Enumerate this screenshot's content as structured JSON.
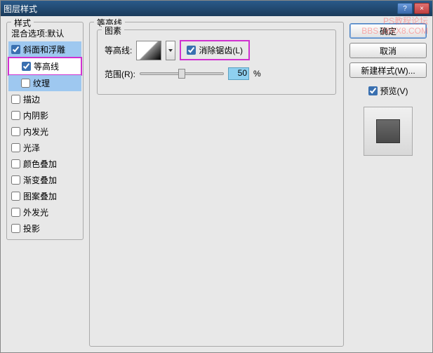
{
  "window": {
    "title": "图层样式"
  },
  "watermark": {
    "line1": "PS教程论坛",
    "line2": "BBS.16XX8.COM"
  },
  "sidebar": {
    "legend": "样式",
    "header": "混合选项:默认",
    "items": [
      {
        "label": "斜面和浮雕",
        "checked": true,
        "selected": true
      },
      {
        "label": "等高线",
        "checked": true,
        "highlighted": true
      },
      {
        "label": "纹理",
        "checked": false,
        "selected_light": true
      },
      {
        "label": "描边",
        "checked": false
      },
      {
        "label": "内阴影",
        "checked": false
      },
      {
        "label": "内发光",
        "checked": false
      },
      {
        "label": "光泽",
        "checked": false
      },
      {
        "label": "颜色叠加",
        "checked": false
      },
      {
        "label": "渐变叠加",
        "checked": false
      },
      {
        "label": "图案叠加",
        "checked": false
      },
      {
        "label": "外发光",
        "checked": false
      },
      {
        "label": "投影",
        "checked": false
      }
    ]
  },
  "main": {
    "legend": "等高线",
    "group_legend": "图素",
    "contour_label": "等高线:",
    "antialiased_label": "消除锯齿(L)",
    "antialiased_checked": true,
    "range_label": "范围(R):",
    "range_value": "50",
    "range_unit": "%"
  },
  "buttons": {
    "ok": "确定",
    "cancel": "取消",
    "new_style": "新建样式(W)...",
    "preview_label": "预览(V)",
    "preview_checked": true
  }
}
